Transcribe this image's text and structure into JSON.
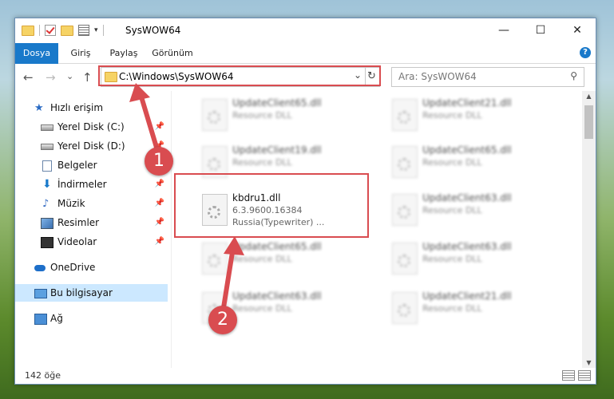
{
  "window": {
    "title": "SysWOW64",
    "min_label": "—",
    "max_label": "☐",
    "close_label": "✕"
  },
  "ribbon": {
    "tabs": [
      "Dosya",
      "Giriş",
      "Paylaş",
      "Görünüm"
    ],
    "help": "?"
  },
  "nav": {
    "back": "←",
    "forward": "→",
    "recent": "⌄",
    "up": "↑",
    "address": "C:\\Windows\\SysWOW64",
    "search_placeholder": "Ara: SysWOW64"
  },
  "sidebar": {
    "quick_access": "Hızlı erişim",
    "items": [
      {
        "label": "Yerel Disk (C:)",
        "icon": "drive-icon"
      },
      {
        "label": "Yerel Disk (D:)",
        "icon": "drive-icon"
      },
      {
        "label": "Belgeler",
        "icon": "documents-icon"
      },
      {
        "label": "İndirmeler",
        "icon": "downloads-icon"
      },
      {
        "label": "Müzik",
        "icon": "music-icon"
      },
      {
        "label": "Resimler",
        "icon": "pictures-icon"
      },
      {
        "label": "Videolar",
        "icon": "videos-icon"
      }
    ],
    "onedrive": "OneDrive",
    "this_pc": "Bu bilgisayar",
    "network": "Ağ"
  },
  "files": [
    {
      "name": "UpdateClient65.dll",
      "type": "Resource DLL"
    },
    {
      "name": "UpdateClient21.dll",
      "type": "Resource DLL"
    },
    {
      "name": "UpdateClient19.dll",
      "type": "Resource DLL"
    },
    {
      "name": "UpdateClient65.dll",
      "type": "Resource DLL"
    },
    {
      "name": "kbdru1.dll",
      "version": "6.3.9600.16384",
      "desc": "Russia(Typewriter) ..."
    },
    {
      "name": "UpdateClient63.dll",
      "type": "Resource DLL"
    },
    {
      "name": "UpdateClient65.dll",
      "type": "Resource DLL"
    },
    {
      "name": "UpdateClient63.dll",
      "type": "Resource DLL"
    },
    {
      "name": "UpdateClient63.dll",
      "type": "Resource DLL"
    },
    {
      "name": "UpdateClient21.dll",
      "type": "Resource DLL"
    }
  ],
  "status": {
    "count": "142 öğe"
  },
  "annotations": {
    "step1": "1",
    "step2": "2"
  },
  "colors": {
    "accent": "#1979ca",
    "highlight": "#d94c50"
  }
}
